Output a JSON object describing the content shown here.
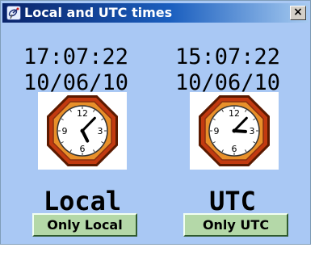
{
  "window": {
    "title": "Local and UTC times",
    "close_label": "×"
  },
  "local": {
    "time": "17:07:22",
    "date": "10/06/10",
    "label": "Local",
    "button": "Only Local",
    "clock": {
      "hour": 5,
      "minute": 7,
      "second": 22
    }
  },
  "utc": {
    "time": "15:07:22",
    "date": "10/06/10",
    "label": "UTC",
    "button": "Only UTC",
    "clock": {
      "hour": 3,
      "minute": 7,
      "second": 22
    }
  },
  "clock_face": {
    "numerals": [
      "12",
      "3",
      "6",
      "9"
    ]
  },
  "colors": {
    "window_bg": "#a9c8f4",
    "button_bg": "#b4d8a8",
    "clock_frame": "#c23a10",
    "title_bar": "#0a246a"
  }
}
